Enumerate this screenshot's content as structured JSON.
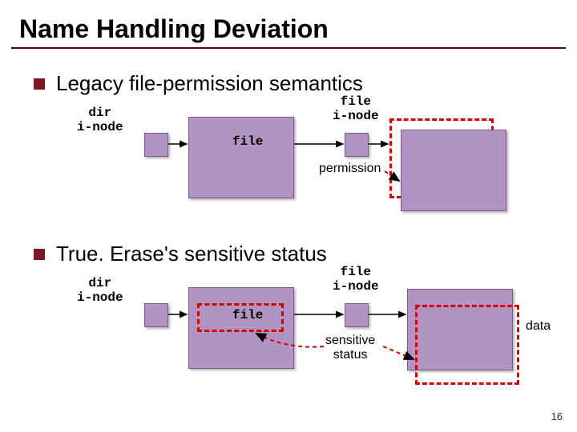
{
  "title": "Name Handling Deviation",
  "bullets": {
    "legacy": "Legacy file-permission semantics",
    "trueerase": "True. Erase's sensitive status"
  },
  "labels": {
    "dir_inode": "dir\ni-node",
    "file_inode": "file\ni-node",
    "file": "file",
    "permission": "permission",
    "data": "data",
    "sensitive_status": "sensitive\nstatus"
  },
  "page_number": "16"
}
